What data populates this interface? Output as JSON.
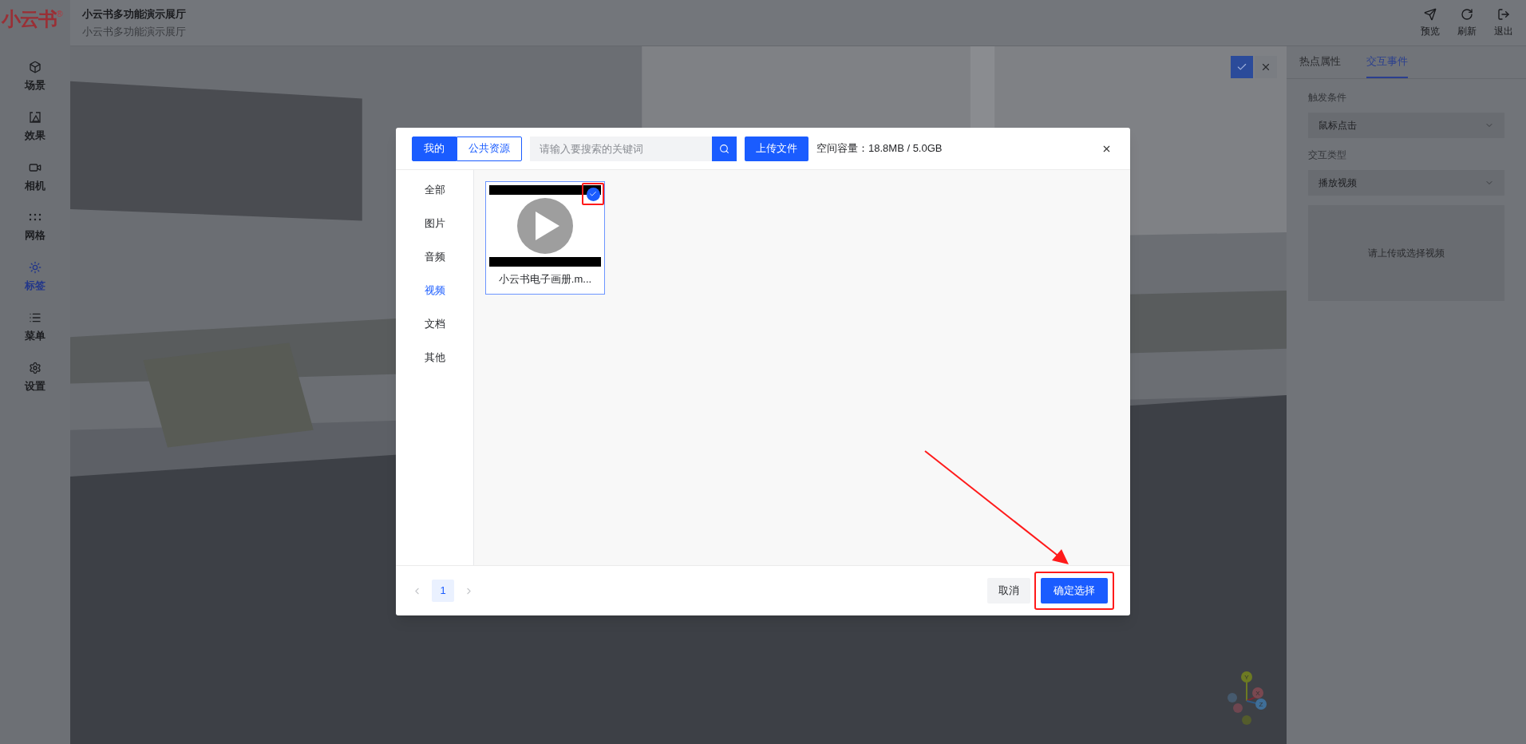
{
  "logo": {
    "text": "小云书",
    "mark": "®"
  },
  "header": {
    "title": "小云书多功能演示展厅",
    "subtitle": "小云书多功能演示展厅",
    "actions": [
      {
        "label": "预览",
        "kind": "send"
      },
      {
        "label": "刷新",
        "kind": "refresh"
      },
      {
        "label": "退出",
        "kind": "exit"
      }
    ]
  },
  "sidebar": {
    "items": [
      {
        "label": "场景",
        "kind": "cube",
        "selected": false
      },
      {
        "label": "效果",
        "kind": "effect",
        "selected": false
      },
      {
        "label": "相机",
        "kind": "camera",
        "selected": false
      },
      {
        "label": "网格",
        "kind": "grid",
        "selected": false
      },
      {
        "label": "标签",
        "kind": "tag",
        "selected": true
      },
      {
        "label": "菜单",
        "kind": "menu",
        "selected": false
      },
      {
        "label": "设置",
        "kind": "settings",
        "selected": false
      }
    ]
  },
  "viewport": {
    "gizmo": [
      "Y",
      "X",
      "Z"
    ]
  },
  "panel": {
    "tabs": [
      {
        "label": "热点属性",
        "selected": false
      },
      {
        "label": "交互事件",
        "selected": true
      }
    ],
    "fields": [
      {
        "label": "触发条件",
        "value": "鼠标点击"
      },
      {
        "label": "交互类型",
        "value": "播放视频"
      }
    ],
    "video_placeholder": "请上传或选择视频"
  },
  "dialog": {
    "sources": [
      {
        "label": "我的",
        "selected": true
      },
      {
        "label": "公共资源",
        "selected": false
      }
    ],
    "search": {
      "placeholder": "请输入要搜索的关键词"
    },
    "upload": "上传文件",
    "capacity": "空间容量：18.8MB / 5.0GB",
    "categories": [
      {
        "label": "全部",
        "selected": false
      },
      {
        "label": "图片",
        "selected": false
      },
      {
        "label": "音频",
        "selected": false
      },
      {
        "label": "视频",
        "selected": true
      },
      {
        "label": "文档",
        "selected": false
      },
      {
        "label": "其他",
        "selected": false
      }
    ],
    "files": [
      {
        "name": "小云书电子画册.m...",
        "selected": true
      }
    ],
    "pages": [
      {
        "label": "1",
        "selected": true
      }
    ],
    "cancel": "取消",
    "confirm": "确定选择"
  }
}
